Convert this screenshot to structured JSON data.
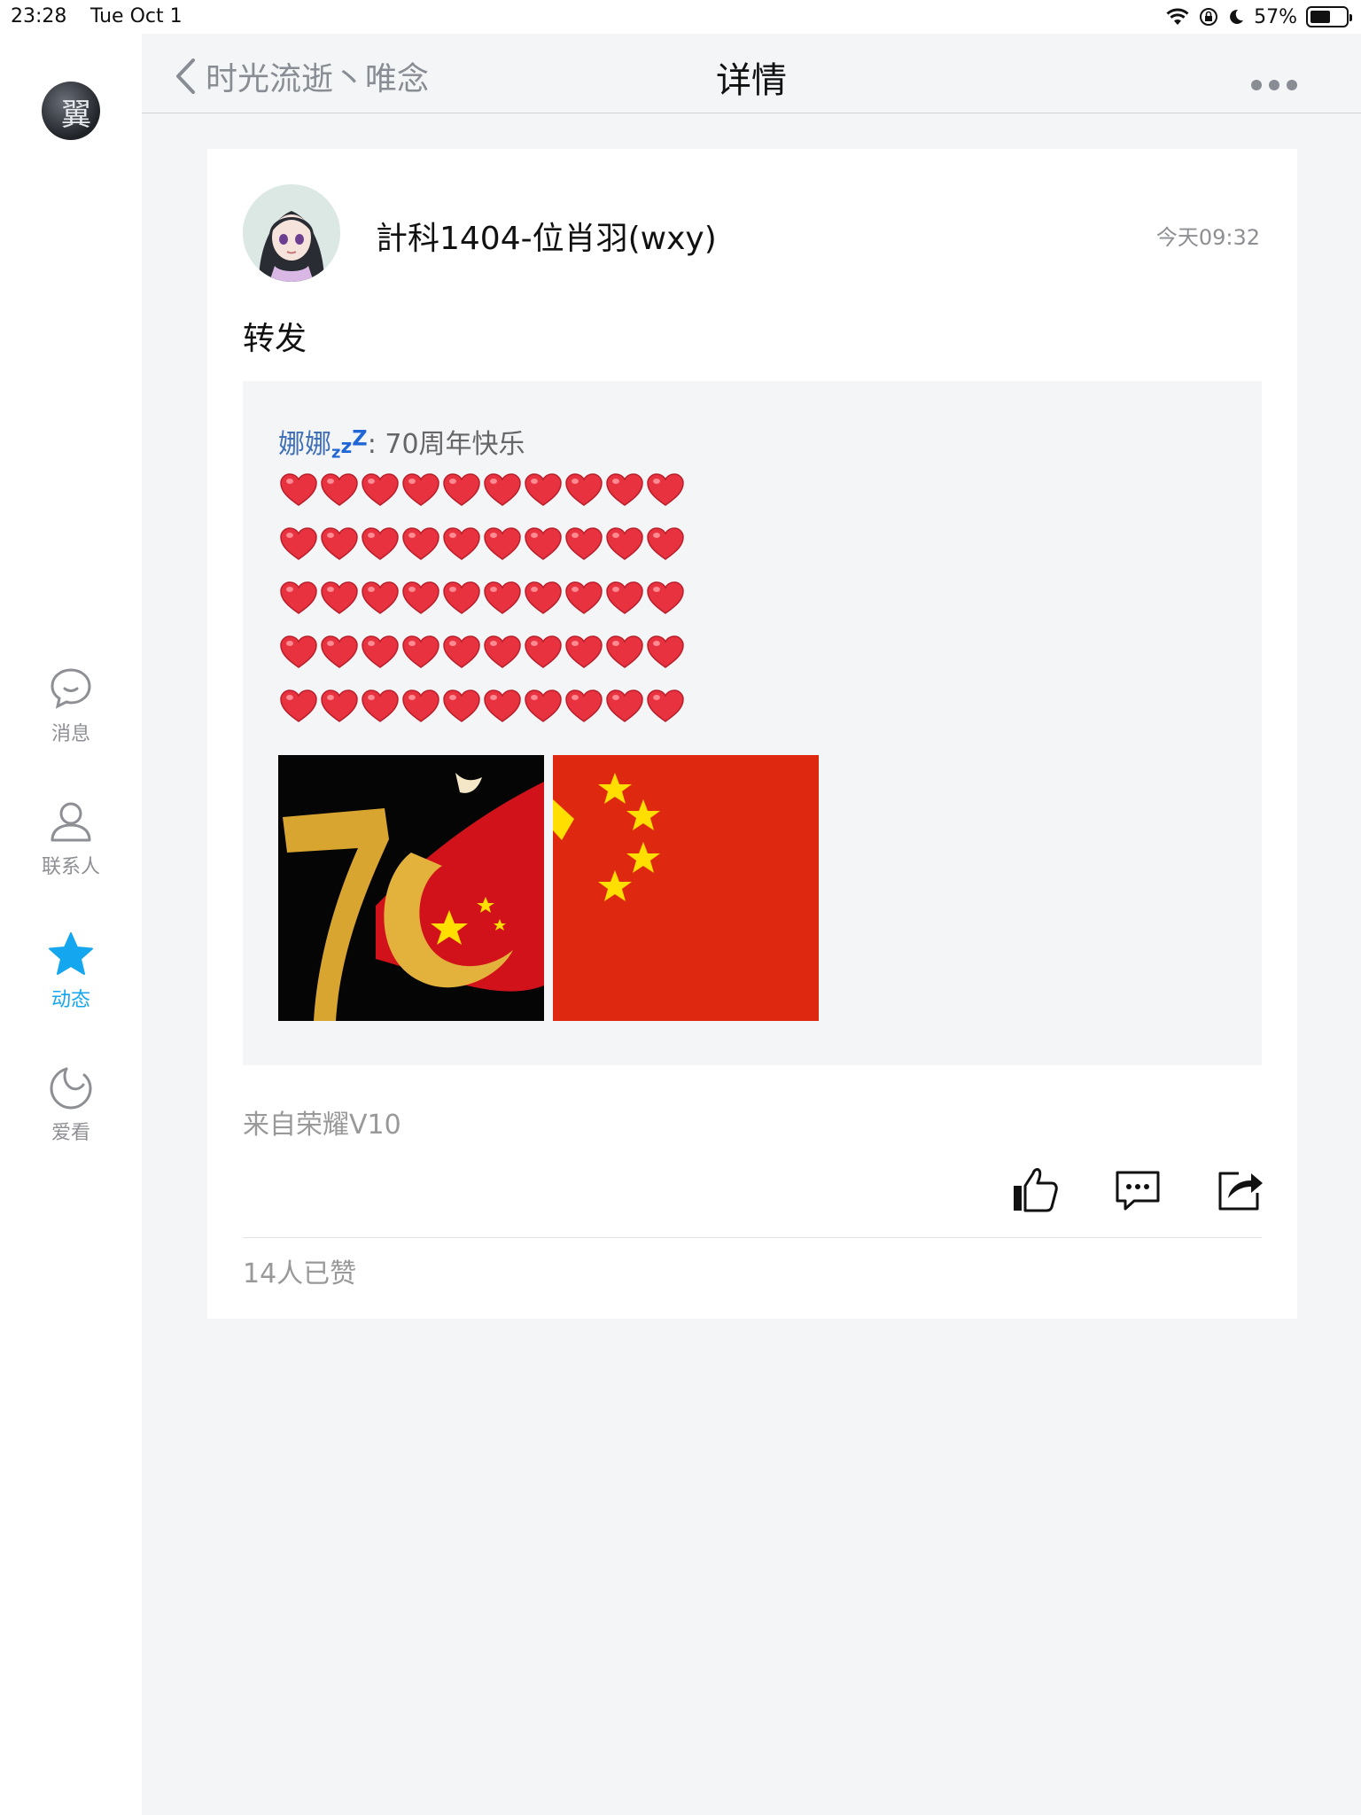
{
  "status_bar": {
    "time": "23:28",
    "date": "Tue Oct 1",
    "battery": "57%",
    "battery_level": 0.57
  },
  "sidebar": {
    "avatar_text": "翼",
    "items": [
      {
        "label": "消息",
        "icon": "chat-bubble-icon",
        "active": false
      },
      {
        "label": "联系人",
        "icon": "contact-person-icon",
        "active": false
      },
      {
        "label": "动态",
        "icon": "star-icon",
        "active": true
      },
      {
        "label": "爱看",
        "icon": "moon-swirl-icon",
        "active": false
      }
    ]
  },
  "header": {
    "back_label": "时光流逝丶唯念",
    "title": "详情",
    "more_icon": "more-dots-icon"
  },
  "post": {
    "author": "計科1404-位肖羽(wxy)",
    "time": "今天09:32",
    "text": "转发",
    "repost": {
      "user": "娜娜",
      "user_badge": "zzZ",
      "separator": ": ",
      "content": "70周年快乐",
      "heart_rows": 5,
      "hearts_per_row": 10,
      "images": [
        "70-anniversary-image",
        "china-flag-image"
      ]
    },
    "source": "来自荣耀V10",
    "likes": "14人已赞"
  },
  "colors": {
    "accent": "#14a6ee",
    "heart": "#e8323f",
    "flag_red": "#de2910",
    "flag_yellow": "#ffde00"
  }
}
